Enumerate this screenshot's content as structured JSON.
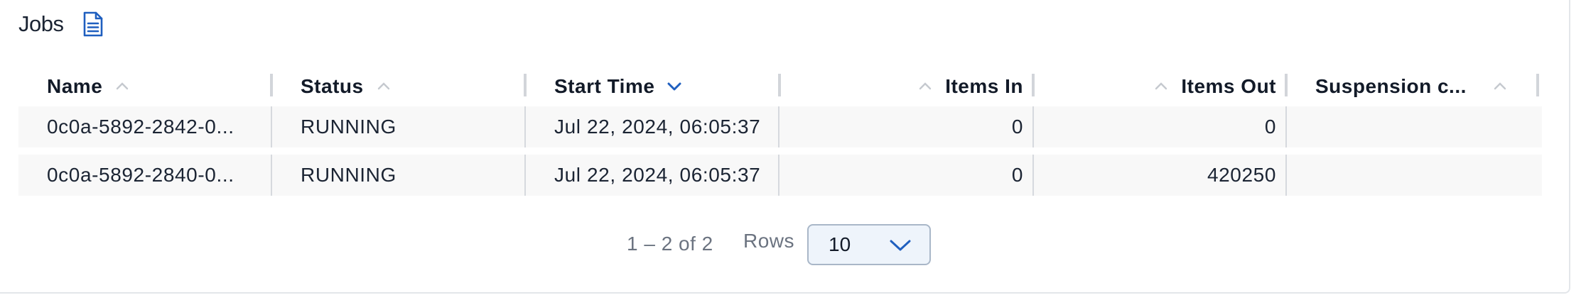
{
  "panel": {
    "title": "Jobs",
    "title_icon": "document-icon"
  },
  "colors": {
    "accent": "#1f5fbf",
    "header_text": "#121a28",
    "row_background": "#f8f8f8",
    "muted_text": "#6b7380",
    "select_background": "#eef4fb",
    "select_border": "#a9b7c8"
  },
  "table": {
    "columns": [
      {
        "label": "Name",
        "sort": "none"
      },
      {
        "label": "Status",
        "sort": "none"
      },
      {
        "label": "Start Time",
        "sort": "descending"
      },
      {
        "label": "Items In",
        "sort": "none"
      },
      {
        "label": "Items Out",
        "sort": "none"
      },
      {
        "label": "Suspension c...",
        "sort": "none"
      }
    ],
    "rows": [
      {
        "name": "0c0a-5892-2842-0...",
        "status": "RUNNING",
        "start_time": "Jul 22, 2024, 06:05:37",
        "items_in": "0",
        "items_out": "0",
        "suspension": ""
      },
      {
        "name": "0c0a-5892-2840-0...",
        "status": "RUNNING",
        "start_time": "Jul 22, 2024, 06:05:37",
        "items_in": "0",
        "items_out": "420250",
        "suspension": ""
      }
    ]
  },
  "pagination": {
    "range_text": "1 – 2 of 2",
    "rows_label": "Rows",
    "rows_per_page": "10"
  }
}
